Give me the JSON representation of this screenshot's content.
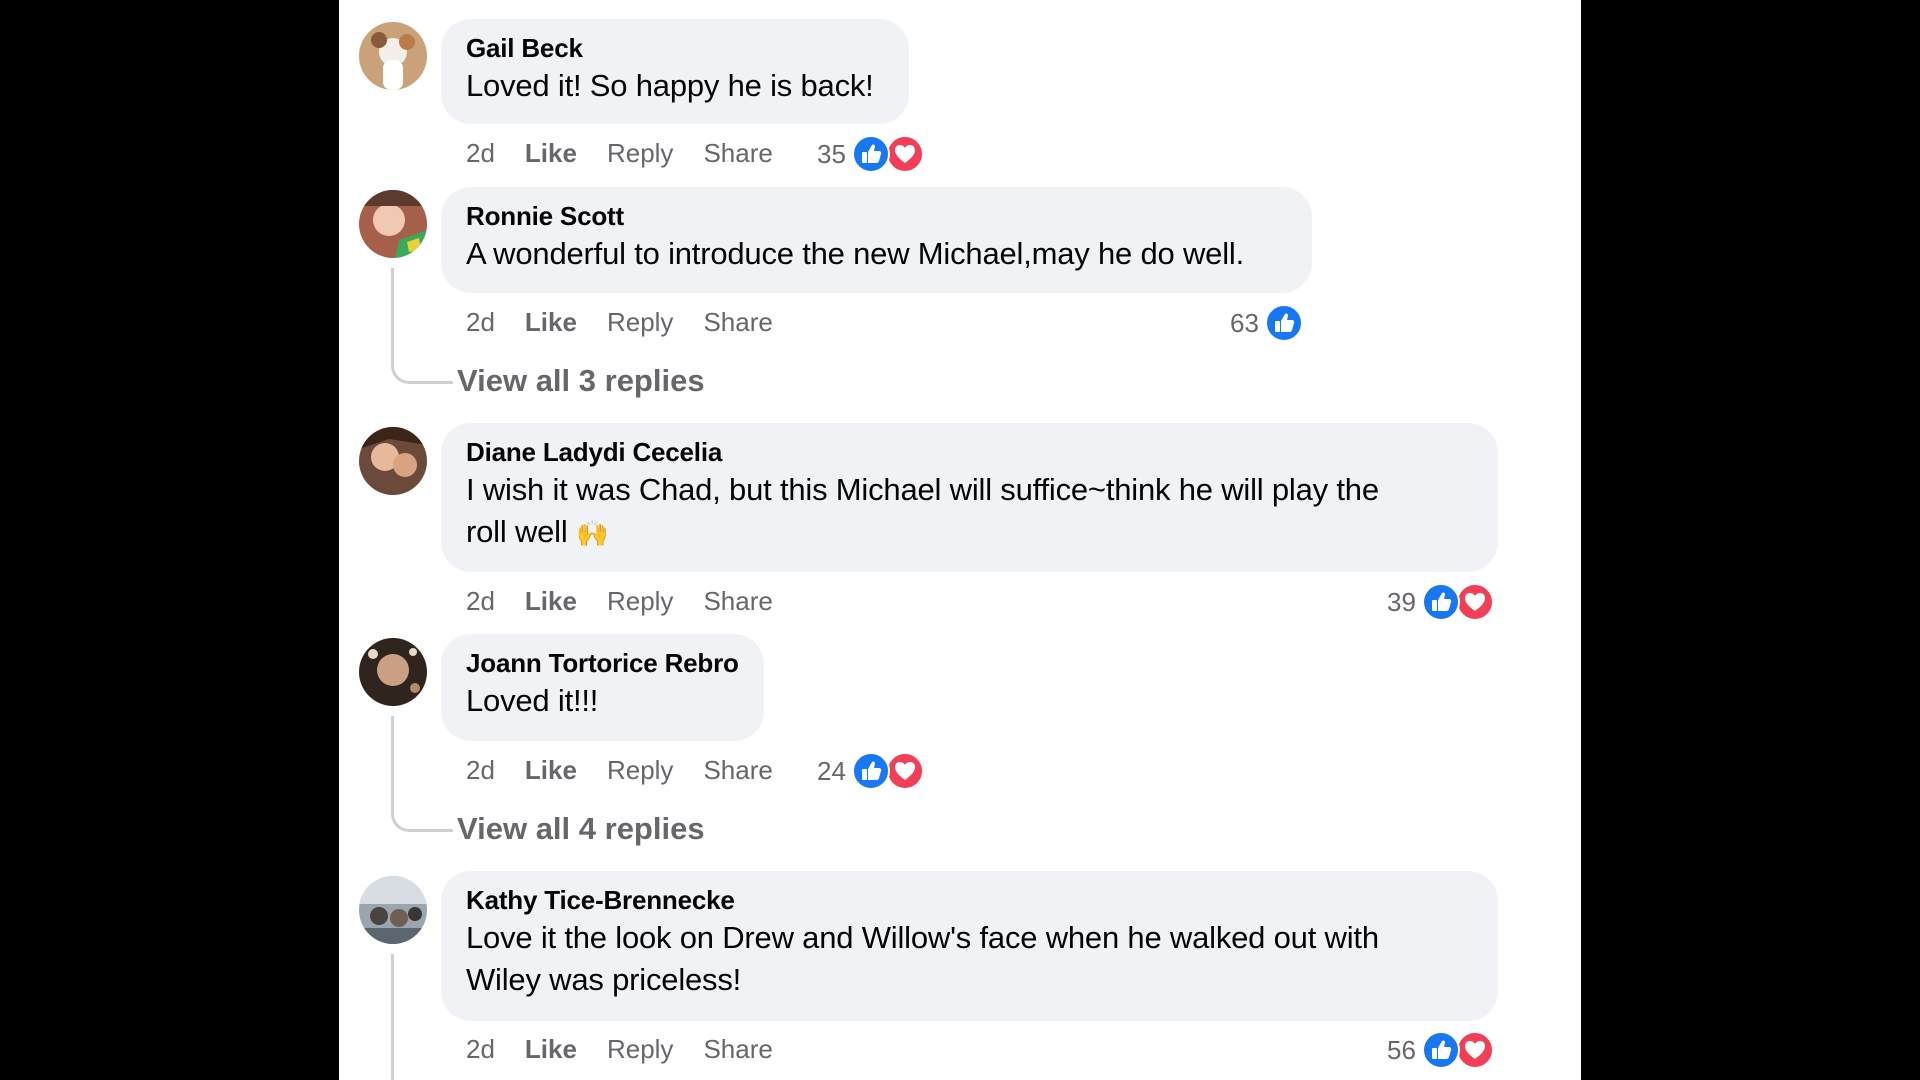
{
  "comments": [
    {
      "author": "Gail Beck",
      "text": "Loved it! So happy he is back!",
      "time": "2d",
      "like": "Like",
      "reply": "Reply",
      "share": "Share",
      "count": "35",
      "reactions": [
        "like-icon",
        "love-icon"
      ]
    },
    {
      "author": "Ronnie Scott",
      "text": "A wonderful to introduce the new Michael,may he do well.",
      "time": "2d",
      "like": "Like",
      "reply": "Reply",
      "share": "Share",
      "count": "63",
      "reactions": [
        "like-icon"
      ],
      "view_replies": "View all 3 replies"
    },
    {
      "author": "Diane Ladydi Cecelia",
      "text_line1": "I wish it was Chad, but this Michael will suffice~think he will play the",
      "text_line2": "roll well",
      "emoji": "🙌",
      "time": "2d",
      "like": "Like",
      "reply": "Reply",
      "share": "Share",
      "count": "39",
      "reactions": [
        "like-icon",
        "love-icon"
      ]
    },
    {
      "author": "Joann Tortorice Rebro",
      "text": "Loved it!!!",
      "time": "2d",
      "like": "Like",
      "reply": "Reply",
      "share": "Share",
      "count": "24",
      "reactions": [
        "like-icon",
        "love-icon"
      ],
      "view_replies": "View all 4 replies"
    },
    {
      "author": "Kathy Tice-Brennecke",
      "text_line1": "Love it the look on Drew and Willow's face when he walked out with",
      "text_line2": "Wiley was priceless!",
      "time": "2d",
      "like": "Like",
      "reply": "Reply",
      "share": "Share",
      "count": "56",
      "reactions": [
        "like-icon",
        "love-icon"
      ]
    }
  ],
  "colors": {
    "background": "#000000",
    "panel": "#ffffff",
    "bubble": "#f0f2f5",
    "secondary_text": "#65676b",
    "like_blue": "#1877f2",
    "love_red": "#f33e58"
  }
}
